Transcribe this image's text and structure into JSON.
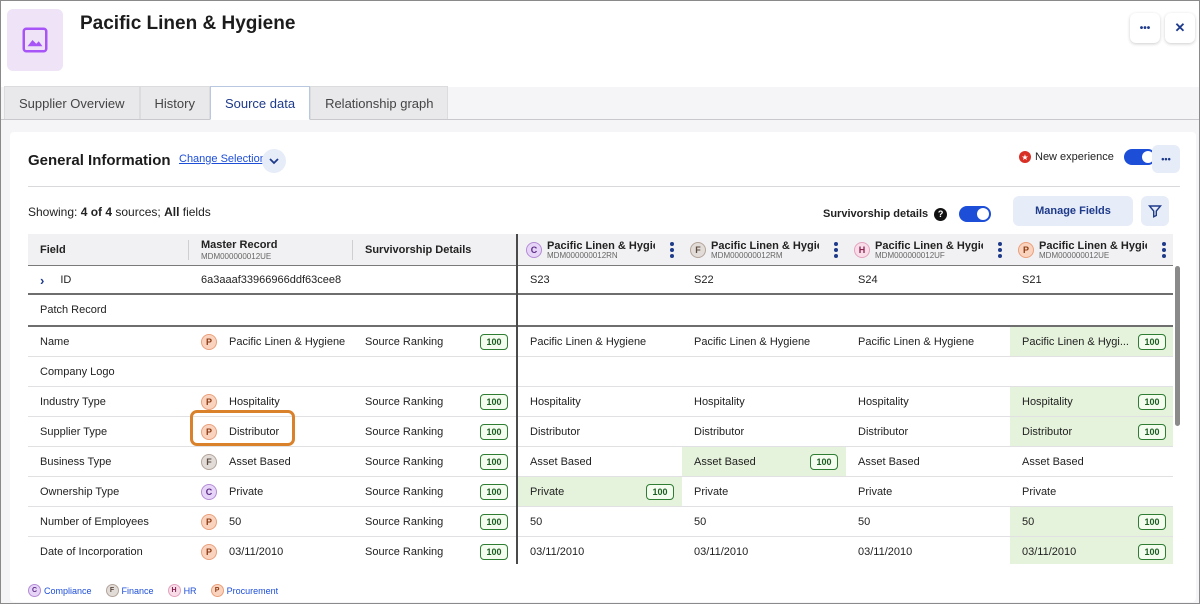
{
  "header": {
    "title": "Pacific Linen & Hygiene",
    "more_label": "•••",
    "close_label": "✕"
  },
  "tabs": [
    {
      "label": "Supplier Overview"
    },
    {
      "label": "History"
    },
    {
      "label": "Source data"
    },
    {
      "label": "Relationship graph"
    }
  ],
  "active_tab": "Source data",
  "section": {
    "title": "General Information",
    "change_selection": "Change Selection",
    "new_experience": "New experience",
    "more_label": "•••"
  },
  "toolbar": {
    "showing_prefix": "Showing: ",
    "showing_count": "4 of 4",
    "showing_mid": " sources; ",
    "showing_all": "All",
    "showing_suffix": " fields",
    "survivorship_label": "Survivorship details",
    "manage_fields": "Manage Fields"
  },
  "columns": {
    "field": "Field",
    "master": "Master Record",
    "master_id": "MDM000000012UE",
    "survivorship": "Survivorship Details"
  },
  "sources": [
    {
      "letter": "C",
      "name": "Pacific Linen & Hygiene",
      "id": "MDM000000012RN"
    },
    {
      "letter": "F",
      "name": "Pacific Linen & Hygiene",
      "id": "MDM000000012RM"
    },
    {
      "letter": "H",
      "name": "Pacific Linen & Hygiene",
      "id": "MDM000000012UF"
    },
    {
      "letter": "P",
      "name": "Pacific Linen & Hygiene",
      "id": "MDM000000012UE"
    }
  ],
  "rows": [
    {
      "field": "ID",
      "expand": "›",
      "master": "6a3aaaf33966966ddf63cee8",
      "src": [
        "S23",
        "S22",
        "S24",
        "S21"
      ]
    },
    {
      "field": "Patch Record"
    },
    {
      "field": "Name",
      "mletter": "P",
      "master": "Pacific Linen & Hygiene",
      "surv": "Source Ranking",
      "score": "100",
      "src": [
        "Pacific Linen & Hygiene",
        "Pacific Linen & Hygiene",
        "Pacific Linen & Hygiene",
        "Pacific Linen & Hygi..."
      ],
      "win": 3
    },
    {
      "field": "Company Logo"
    },
    {
      "field": "Industry Type",
      "mletter": "P",
      "master": "Hospitality",
      "surv": "Source Ranking",
      "score": "100",
      "src": [
        "Hospitality",
        "Hospitality",
        "Hospitality",
        "Hospitality"
      ],
      "win": 3
    },
    {
      "field": "Supplier Type",
      "mletter": "P",
      "master": "Distributor",
      "surv": "Source Ranking",
      "score": "100",
      "src": [
        "Distributor",
        "Distributor",
        "Distributor",
        "Distributor"
      ],
      "win": 3
    },
    {
      "field": "Business Type",
      "mletter": "F",
      "master": "Asset Based",
      "surv": "Source Ranking",
      "score": "100",
      "src": [
        "Asset Based",
        "Asset Based",
        "Asset Based",
        "Asset Based"
      ],
      "win": 1
    },
    {
      "field": "Ownership Type",
      "mletter": "C",
      "master": "Private",
      "surv": "Source Ranking",
      "score": "100",
      "src": [
        "Private",
        "Private",
        "Private",
        "Private"
      ],
      "win": 0
    },
    {
      "field": "Number of Employees",
      "mletter": "P",
      "master": "50",
      "surv": "Source Ranking",
      "score": "100",
      "src": [
        "50",
        "50",
        "50",
        "50"
      ],
      "win": 3
    },
    {
      "field": "Date of Incorporation",
      "mletter": "P",
      "master": "03/11/2010",
      "surv": "Source Ranking",
      "score": "100",
      "src": [
        "03/11/2010",
        "03/11/2010",
        "03/11/2010",
        "03/11/2010"
      ],
      "win": 3
    }
  ],
  "legend": [
    {
      "letter": "C",
      "label": "Compliance"
    },
    {
      "letter": "F",
      "label": "Finance"
    },
    {
      "letter": "H",
      "label": "HR"
    },
    {
      "letter": "P",
      "label": "Procurement"
    }
  ],
  "colors": {
    "accent": "#1d4ed8",
    "winner_bg": "#e6f3dc",
    "highlight": "#d9822b"
  }
}
